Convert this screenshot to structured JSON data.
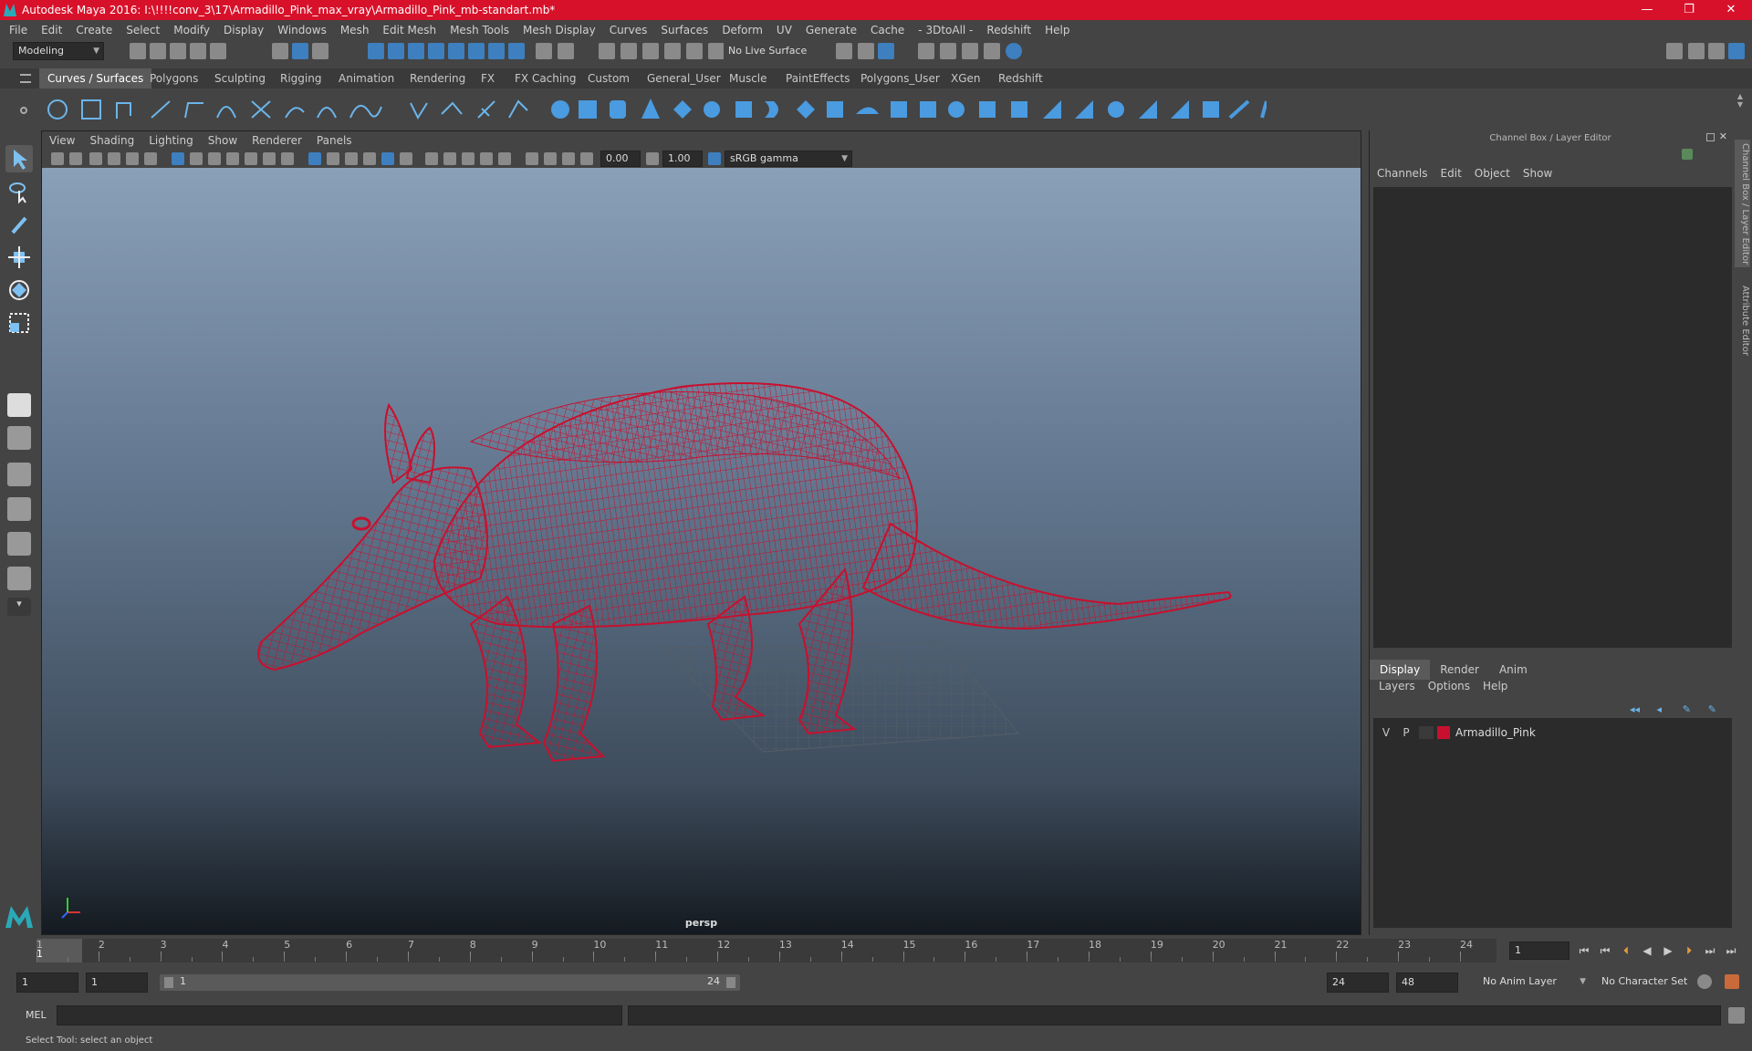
{
  "window": {
    "title": "Autodesk Maya 2016: I:\\!!!!conv_3\\17\\Armadillo_Pink_max_vray\\Armadillo_Pink_mb-standart.mb*",
    "minimize": "—",
    "restore": "❐",
    "close": "✕"
  },
  "menu": [
    "File",
    "Edit",
    "Create",
    "Select",
    "Modify",
    "Display",
    "Windows",
    "Mesh",
    "Edit Mesh",
    "Mesh Tools",
    "Mesh Display",
    "Curves",
    "Surfaces",
    "Deform",
    "UV",
    "Generate",
    "Cache",
    "- 3DtoAll -",
    "Redshift",
    "Help"
  ],
  "statusline": {
    "mode": "Modeling",
    "live_surface": "No Live Surface"
  },
  "shelf_tabs": [
    "Curves / Surfaces",
    "Polygons",
    "Sculpting",
    "Rigging",
    "Animation",
    "Rendering",
    "FX",
    "FX Caching",
    "Custom",
    "General_User",
    "Muscle",
    "PaintEffects",
    "Polygons_User",
    "XGen",
    "Redshift"
  ],
  "panel": {
    "menu": [
      "View",
      "Shading",
      "Lighting",
      "Show",
      "Renderer",
      "Panels"
    ],
    "exposure": "0.00",
    "gamma": "1.00",
    "colorspace": "sRGB gamma",
    "camera": "persp"
  },
  "right_panel": {
    "title": "Channel Box / Layer Editor",
    "menu": [
      "Channels",
      "Edit",
      "Object",
      "Show"
    ],
    "layer_tabs": [
      "Display",
      "Render",
      "Anim"
    ],
    "layer_menu": [
      "Layers",
      "Options",
      "Help"
    ],
    "layer": {
      "v": "V",
      "p": "P",
      "name": "Armadillo_Pink",
      "color": "#c8102e"
    },
    "side_tab_1": "Channel Box / Layer Editor",
    "side_tab_2": "Attribute Editor"
  },
  "model": {
    "wire_color": "#c8102e"
  },
  "timeline": {
    "ticks": [
      "1",
      "2",
      "3",
      "4",
      "5",
      "6",
      "7",
      "8",
      "9",
      "10",
      "11",
      "12",
      "13",
      "14",
      "15",
      "16",
      "17",
      "18",
      "19",
      "20",
      "21",
      "22",
      "23",
      "24"
    ],
    "current_marker": "1",
    "current_frame": "1"
  },
  "range": {
    "start": "1",
    "anim_start": "1",
    "range_start": "1",
    "range_end": "24",
    "end": "24",
    "anim_end": "48",
    "anim_layer": "No Anim Layer",
    "character_set": "No Character Set"
  },
  "cmd": {
    "label": "MEL"
  },
  "help": {
    "text": "Select Tool: select an object"
  }
}
